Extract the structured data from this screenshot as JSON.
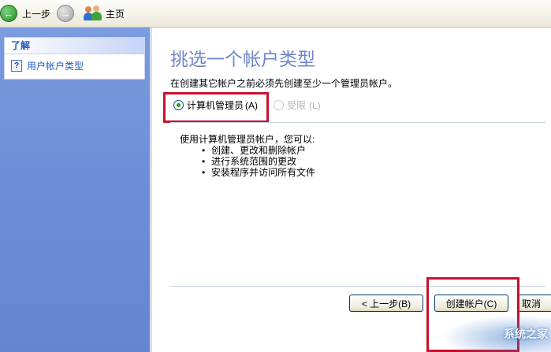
{
  "toolbar": {
    "back_label": "上一步",
    "home_label": "主页"
  },
  "left_pane": {
    "learn_header": "了解",
    "learn_item": "用户帐户类型"
  },
  "main": {
    "title": "挑选一个帐户类型",
    "instruction": "在创建其它帐户之前必须先创建至少一个管理员帐户。",
    "options": [
      {
        "label": "计算机管理员",
        "accel": "(A)",
        "selected": true,
        "enabled": true
      },
      {
        "label": "受限",
        "accel": "(L)",
        "selected": false,
        "enabled": false
      }
    ],
    "description_intro": "使用计算机管理员帐户，您可以:",
    "description_items": [
      "创建、更改和删除帐户",
      "进行系统范围的更改",
      "安装程序并访问所有文件"
    ]
  },
  "buttons": {
    "back": "< 上一步(B)",
    "create": "创建帐户(C)",
    "cancel": "取消"
  },
  "watermark": "系统之家",
  "colors": {
    "title_blue": "#6f86c9",
    "left_pane_blue": "#6f8fd8",
    "highlight_red": "#c8102e",
    "radio_green": "#21a121"
  }
}
